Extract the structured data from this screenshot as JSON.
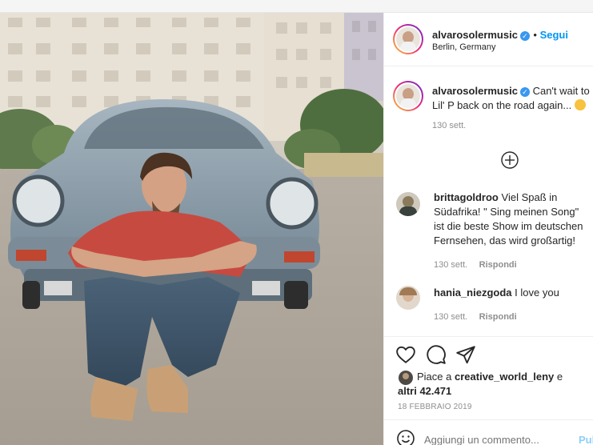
{
  "header": {
    "username": "alvarosolermusic",
    "follow_label": "Segui",
    "location": "Berlin, Germany"
  },
  "caption": {
    "username": "alvarosolermusic",
    "line1": "Can't wait to",
    "line2": "Lil' P back on the road again...",
    "time": "130 sett."
  },
  "comments": [
    {
      "username": "brittagoldroo",
      "line1": "Viel Spaß in",
      "line2": "Südafrika! \" Sing meinen Song\"",
      "line3": "ist die beste Show im deutschen",
      "line4": "Fernsehen, das wird großartig!",
      "time": "130 sett.",
      "reply": "Rispondi"
    },
    {
      "username": "hania_niezgoda",
      "text": "I love you",
      "time": "130 sett.",
      "reply": "Rispondi"
    }
  ],
  "likes": {
    "prefix": "Piace a",
    "user": "creative_world_leny",
    "conj": "e",
    "others": "altri 42.471"
  },
  "date": "18 FEBBRAIO 2019",
  "comment_box": {
    "placeholder": "Aggiungi un commento...",
    "post_label": "Pub"
  },
  "colors": {
    "link_blue": "#0095f6",
    "verified_blue": "#3897f0",
    "muted_gray": "#8e8e8e",
    "text": "#262626"
  },
  "icons": [
    "add-circle-icon",
    "heart-icon",
    "comment-icon",
    "share-icon",
    "emoji-icon",
    "smile-emoji-icon"
  ]
}
